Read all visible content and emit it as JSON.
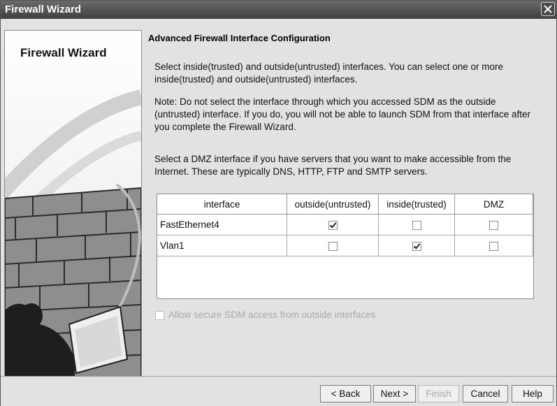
{
  "window": {
    "title": "Firewall Wizard"
  },
  "side_panel": {
    "title": "Firewall Wizard"
  },
  "content": {
    "heading": "Advanced Firewall Interface Configuration",
    "paragraph1": "Select inside(trusted) and outside(untrusted) interfaces. You can select one or more inside(trusted) and outside(untrusted) interfaces.",
    "paragraph2": "Note: Do not select the interface through which you accessed SDM as the outside (untrusted) interface. If you do, you will not be able to launch SDM from that interface after you complete the Firewall Wizard.",
    "paragraph3": "Select a DMZ interface if you have servers that you want to make accessible from the Internet. These are typically DNS, HTTP, FTP and SMTP servers."
  },
  "table": {
    "columns": [
      "interface",
      "outside(untrusted)",
      "inside(trusted)",
      "DMZ"
    ],
    "rows": [
      {
        "interface": "FastEthernet4",
        "outside": true,
        "inside": false,
        "dmz": false
      },
      {
        "interface": "Vlan1",
        "outside": false,
        "inside": true,
        "dmz": false
      }
    ]
  },
  "allow_checkbox": {
    "label": "Allow secure SDM access from outside interfaces",
    "checked": false,
    "enabled": false
  },
  "buttons": {
    "back": "< Back",
    "next": "Next >",
    "finish": "Finish",
    "cancel": "Cancel",
    "help": "Help"
  },
  "colors": {
    "titlebar": "#4f4f4f",
    "background": "#e2e2e2"
  }
}
